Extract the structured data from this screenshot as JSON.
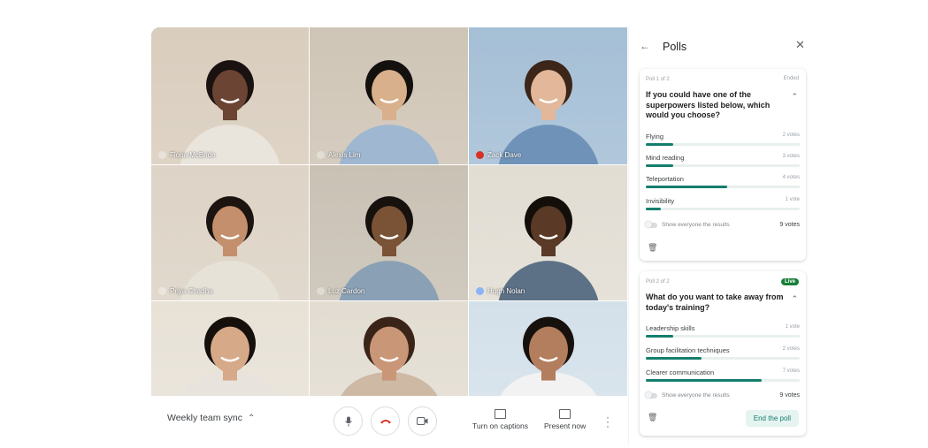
{
  "meeting": {
    "title": "Weekly team sync"
  },
  "participants": [
    {
      "name": "Fiona McBride",
      "mic": "on",
      "bg": "#d9cdbd",
      "skin": "#6b4433",
      "hair": "#1a1210",
      "shirt": "#e9e4dc"
    },
    {
      "name": "Alexis Lim",
      "mic": "on",
      "bg": "#cfc5b6",
      "skin": "#d9b08c",
      "hair": "#14100e",
      "shirt": "#9fb7d0"
    },
    {
      "name": "Zack Dave",
      "mic": "muted",
      "bg": "#a5bfd6",
      "skin": "#e2b79a",
      "hair": "#3b2619",
      "shirt": "#6f93b8"
    },
    {
      "name": "Priya Chadha",
      "mic": "on",
      "bg": "#ddd3c6",
      "skin": "#c48f6c",
      "hair": "#1c1410",
      "shirt": "#e7e2d8"
    },
    {
      "name": "Luz Cardon",
      "mic": "on",
      "bg": "#c9c1b4",
      "skin": "#7a5236",
      "hair": "#17110d",
      "shirt": "#8aa1b5"
    },
    {
      "name": "Hugh Nolan",
      "mic": "speaking",
      "bg": "#e2ddd3",
      "skin": "#5a3a26",
      "hair": "#140e0a",
      "shirt": "#5c7186"
    },
    {
      "name": "",
      "mic": "none",
      "bg": "#e7e1d6",
      "skin": "#d6a988",
      "hair": "#15100c",
      "shirt": "#e8e4dd"
    },
    {
      "name": "",
      "mic": "none",
      "bg": "#e2dcd1",
      "skin": "#c99677",
      "hair": "#3a2417",
      "shirt": "#cdb9a4"
    },
    {
      "name": "",
      "mic": "none",
      "bg": "#d3e0ea",
      "skin": "#b37e5d",
      "hair": "#17110d",
      "shirt": "#f2f2f2"
    }
  ],
  "controls": {
    "captions_label": "Turn on captions",
    "present_label": "Present now"
  },
  "panel": {
    "title": "Polls",
    "polls": [
      {
        "meta": "Poll 1 of 2",
        "state": "Ended",
        "question": "If you could have one of the superpowers listed below, which would you choose?",
        "options": [
          {
            "label": "Flying",
            "count": "2 votes",
            "fraction": 0.18
          },
          {
            "label": "Mind reading",
            "count": "3 votes",
            "fraction": 0.18
          },
          {
            "label": "Teleportation",
            "count": "4 votes",
            "fraction": 0.53
          },
          {
            "label": "Invisibility",
            "count": "1 vote",
            "fraction": 0.1
          }
        ],
        "toggle_label": "Show everyone the results",
        "total_votes": "9 votes"
      },
      {
        "meta": "Poll 2 of 2",
        "state": "Live",
        "question": "What do you want to take away from today's training?",
        "options": [
          {
            "label": "Leadership skills",
            "count": "1 vote",
            "fraction": 0.18
          },
          {
            "label": "Group facilitation techniques",
            "count": "2 votes",
            "fraction": 0.36
          },
          {
            "label": "Clearer communication",
            "count": "7 votes",
            "fraction": 0.75
          }
        ],
        "toggle_label": "Show everyone the results",
        "total_votes": "9 votes",
        "end_label": "End the poll"
      }
    ]
  }
}
